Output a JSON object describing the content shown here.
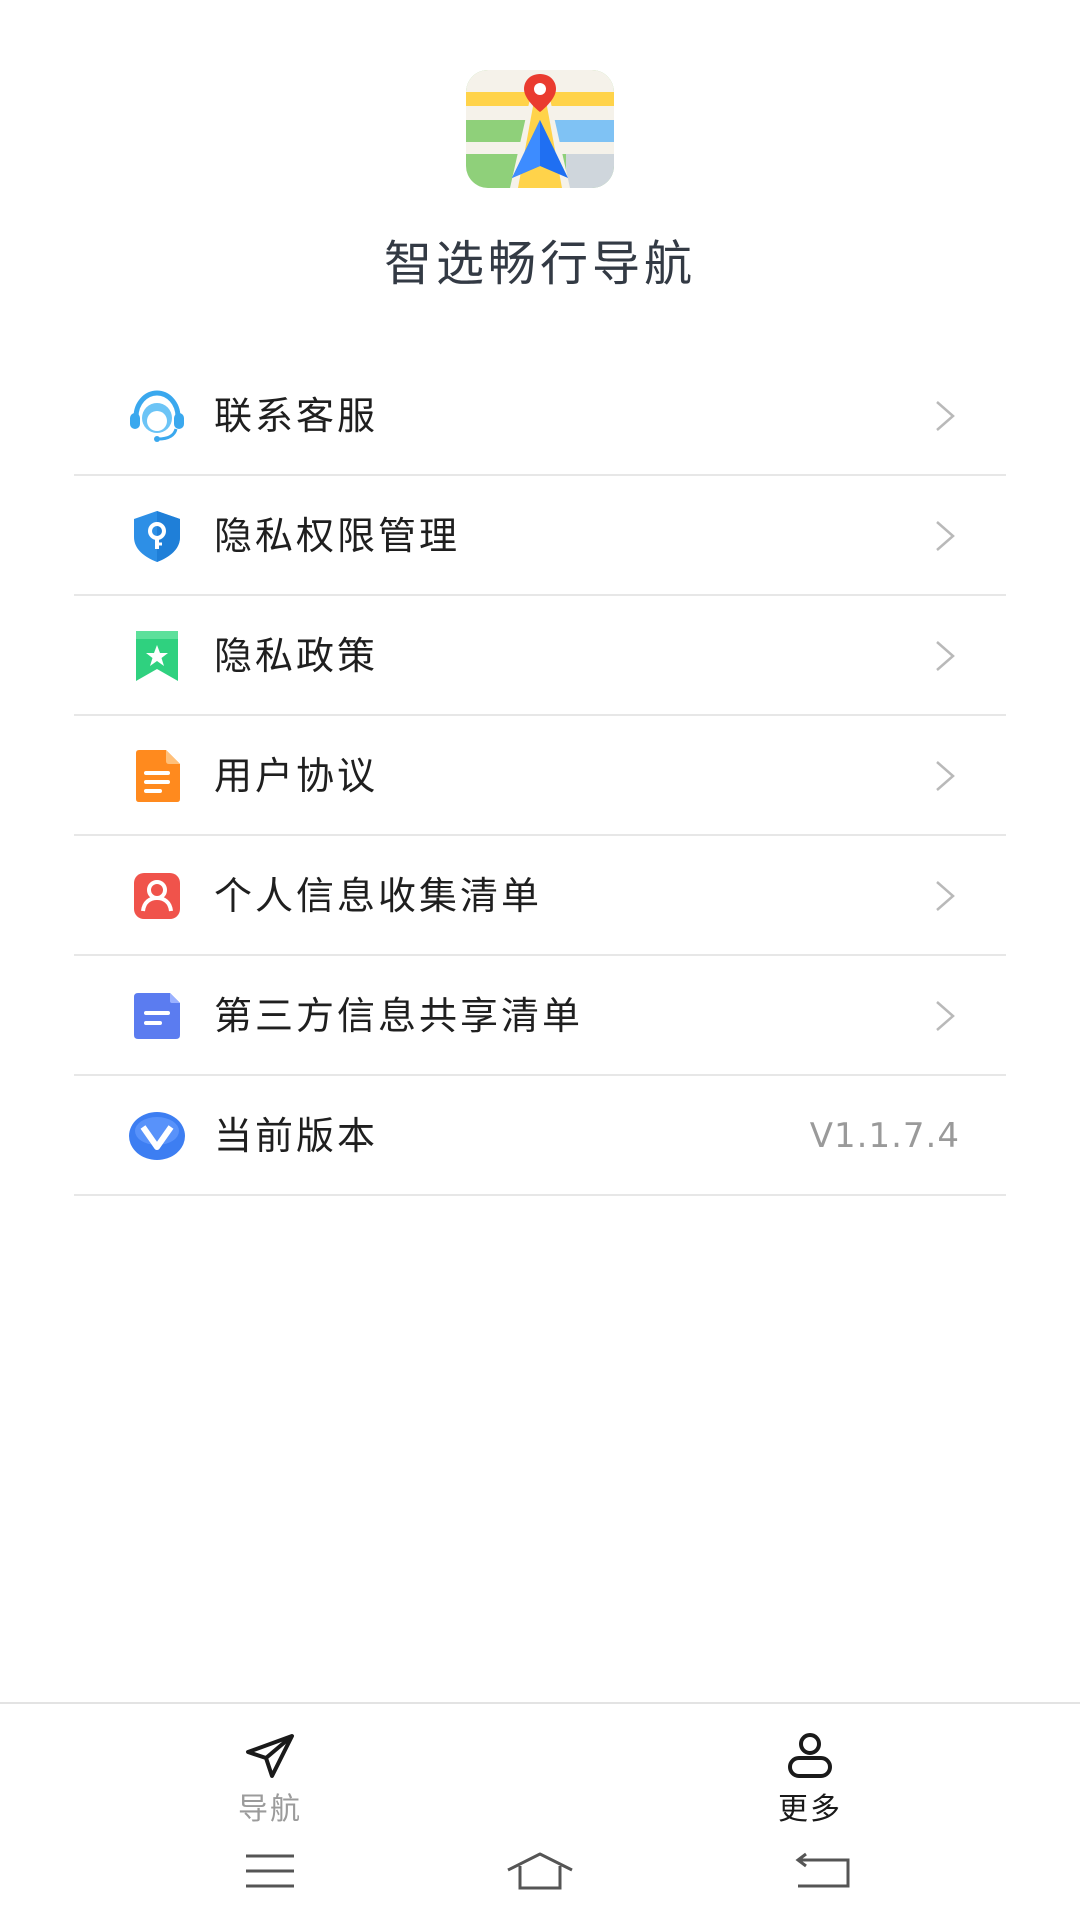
{
  "app": {
    "title": "智选畅行导航",
    "logo_icon": "map-navigation-logo-icon"
  },
  "menu": {
    "items": [
      {
        "label": "联系客服",
        "icon": "customer-service-icon"
      },
      {
        "label": "隐私权限管理",
        "icon": "shield-key-icon"
      },
      {
        "label": "隐私政策",
        "icon": "bookmark-star-icon"
      },
      {
        "label": "用户协议",
        "icon": "document-icon"
      },
      {
        "label": "个人信息收集清单",
        "icon": "person-card-icon"
      },
      {
        "label": "第三方信息共享清单",
        "icon": "list-document-icon"
      }
    ],
    "version": {
      "label": "当前版本",
      "value": "V1.1.7.4",
      "icon": "version-v-icon"
    }
  },
  "tabbar": {
    "tabs": [
      {
        "label": "导航",
        "icon": "navigation-arrow-icon",
        "active": false
      },
      {
        "label": "更多",
        "icon": "person-icon",
        "active": true
      }
    ]
  },
  "colors": {
    "title_text": "#333a44",
    "label_text": "#1f1f1f",
    "muted_text": "#9a9a9a",
    "divider": "#e7e7e7",
    "service_blue": "#3aa8ee",
    "shield_blue": "#2d8fe6",
    "bookmark_green": "#2fd17f",
    "doc_orange": "#ff8a1e",
    "person_red": "#f0534b",
    "list_indigo": "#5b7cf0",
    "version_blue": "#3d7ef2"
  }
}
